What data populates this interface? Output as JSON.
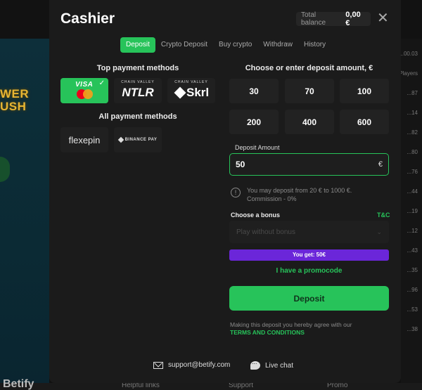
{
  "background": {
    "footer": [
      "Helpful links",
      "Support",
      "Promo"
    ],
    "brand": "Betify",
    "side_numbers": [
      "...00.03",
      "Players",
      "...87",
      "...14",
      "...82",
      "...80",
      "...76",
      "...44",
      "...19",
      "...12",
      "...43",
      "...35",
      "...96",
      "...53",
      "...38"
    ]
  },
  "modal": {
    "title": "Cashier",
    "balance_label": "Total balance",
    "balance_value": "0,00 €",
    "close_icon": "close-icon"
  },
  "tabs": [
    {
      "label": "Deposit",
      "active": true
    },
    {
      "label": "Crypto Deposit",
      "active": false
    },
    {
      "label": "Buy crypto",
      "active": false
    },
    {
      "label": "Withdraw",
      "active": false
    },
    {
      "label": "History",
      "active": false
    }
  ],
  "payment": {
    "top_title": "Top payment methods",
    "all_title": "All payment methods",
    "top_methods": [
      {
        "name": "VISA",
        "selected": true
      },
      {
        "name": "NTLR",
        "small": "CHAIN VALLEY"
      },
      {
        "name": "Skrl",
        "small": "CHAIN VALLEY"
      }
    ],
    "all_methods": [
      {
        "name": "flexepin"
      },
      {
        "name": "BINANCE PAY"
      }
    ]
  },
  "amount": {
    "title": "Choose or enter deposit amount, €",
    "presets": [
      "30",
      "70",
      "100",
      "200",
      "400",
      "600"
    ],
    "field_label": "Deposit Amount",
    "field_value": "50",
    "currency": "€",
    "info": "You may deposit from 20 € to 1000 €. Commission - 0%"
  },
  "bonus": {
    "label": "Choose a bonus",
    "tc": "T&C",
    "placeholder": "Play without bonus",
    "you_get": "You get: 50€",
    "promo": "I have a promocode"
  },
  "deposit_button": "Deposit",
  "agreement": {
    "text": "Making this deposit you hereby agree with our",
    "link": "TERMS AND CONDITIONS"
  },
  "contacts": {
    "email": "support@betify.com",
    "chat": "Live chat"
  },
  "colors": {
    "accent": "#27c35a",
    "bonus": "#6b26d9",
    "modal": "#1b1b1b"
  }
}
